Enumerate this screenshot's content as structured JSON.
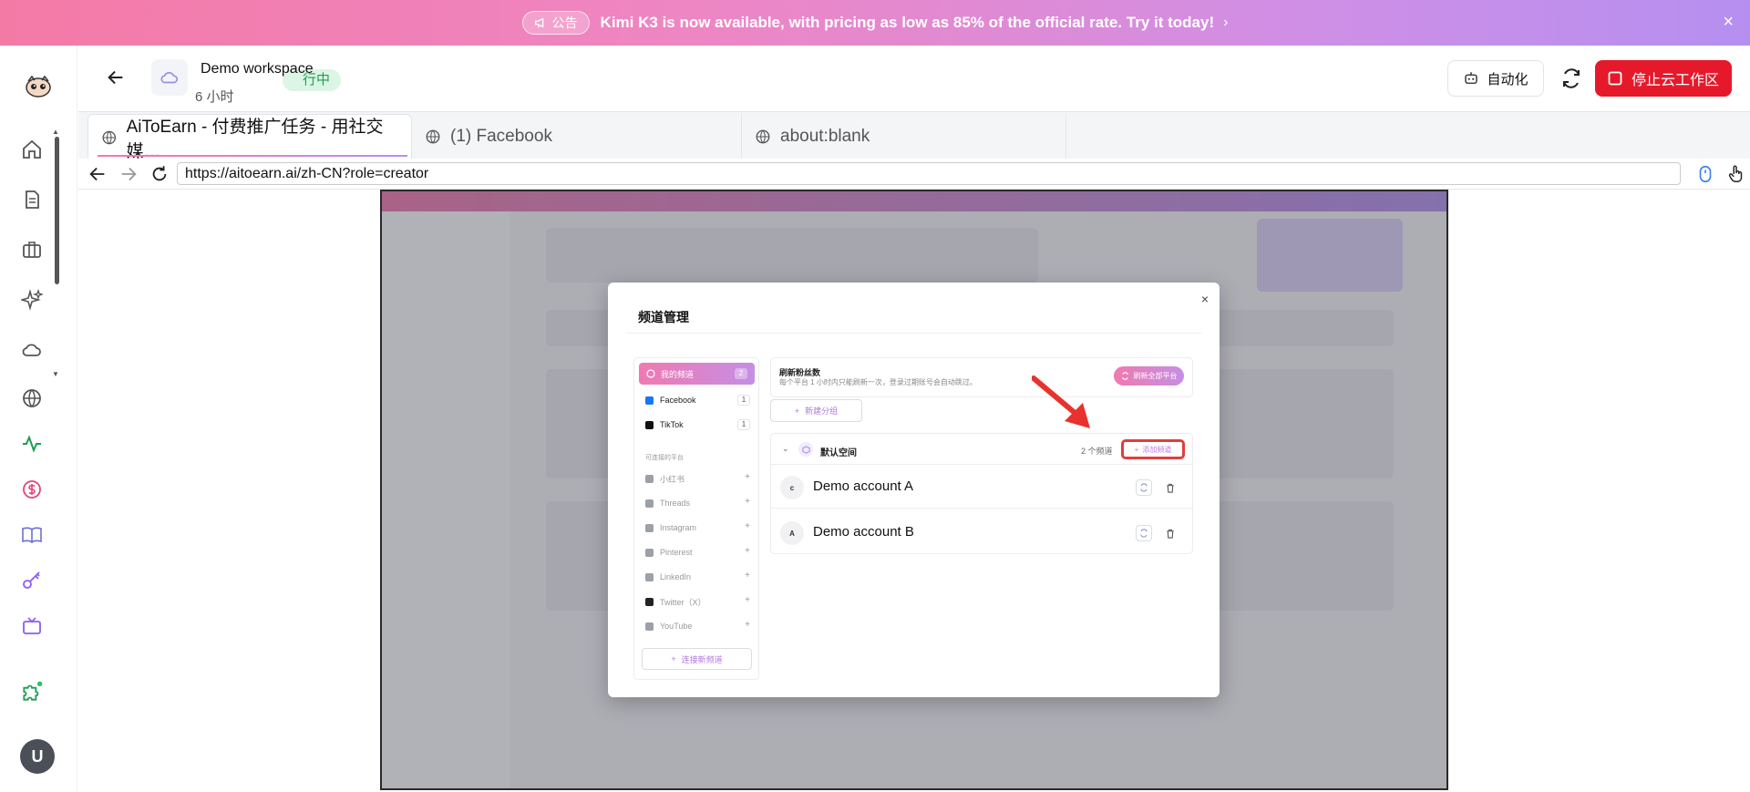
{
  "banner": {
    "badge": "公告",
    "message": "Kimi K3 is now available, with pricing as low as 85% of the official rate. Try it today!",
    "chevron": "›",
    "close": "×"
  },
  "rail": {
    "avatar": "U"
  },
  "workspace": {
    "name": "Demo workspace",
    "status": "行中",
    "time": "6 小时",
    "auto_label": "自动化",
    "stop_label": "停止云工作区"
  },
  "tabs": [
    {
      "label": "AiToEarn - 付费推广任务 - 用社交媒…"
    },
    {
      "label": "(1) Facebook"
    },
    {
      "label": "about:blank"
    }
  ],
  "url": "https://aitoearn.ai/zh-CN?role=creator",
  "modal": {
    "title": "频道管理",
    "close": "×",
    "my_channels_label": "我的频道",
    "my_channels_count": "2",
    "platforms": [
      {
        "name": "Facebook",
        "count": "1",
        "color": "#1877f2"
      },
      {
        "name": "TikTok",
        "count": "1",
        "color": "#111111"
      }
    ],
    "available_section": "可连接的平台",
    "available": [
      {
        "name": "小红书"
      },
      {
        "name": "Threads"
      },
      {
        "name": "Instagram"
      },
      {
        "name": "Pinterest"
      },
      {
        "name": "LinkedIn"
      },
      {
        "name": "Twitter（X）"
      },
      {
        "name": "YouTube"
      }
    ],
    "connect_label": "连接新频道",
    "refresh_title": "刷新粉丝数",
    "refresh_sub": "每个平台 1 小时内只能刷新一次，登录过期账号会自动跳过。",
    "refresh_all_label": "刷新全部平台",
    "new_group_label": "新建分组",
    "group": {
      "name": "默认空间",
      "count": "2 个频道",
      "add_label": "添加频道",
      "accounts": [
        {
          "initial": "c",
          "name": "Demo account A"
        },
        {
          "initial": "A",
          "name": "Demo account B"
        }
      ]
    }
  },
  "colors": {
    "accent_pink": "#f07ab0",
    "accent_purple": "#c58ee6",
    "stop_red": "#e6192b",
    "status_green": "#1f9d55",
    "highlight_red": "#e23d3d"
  }
}
